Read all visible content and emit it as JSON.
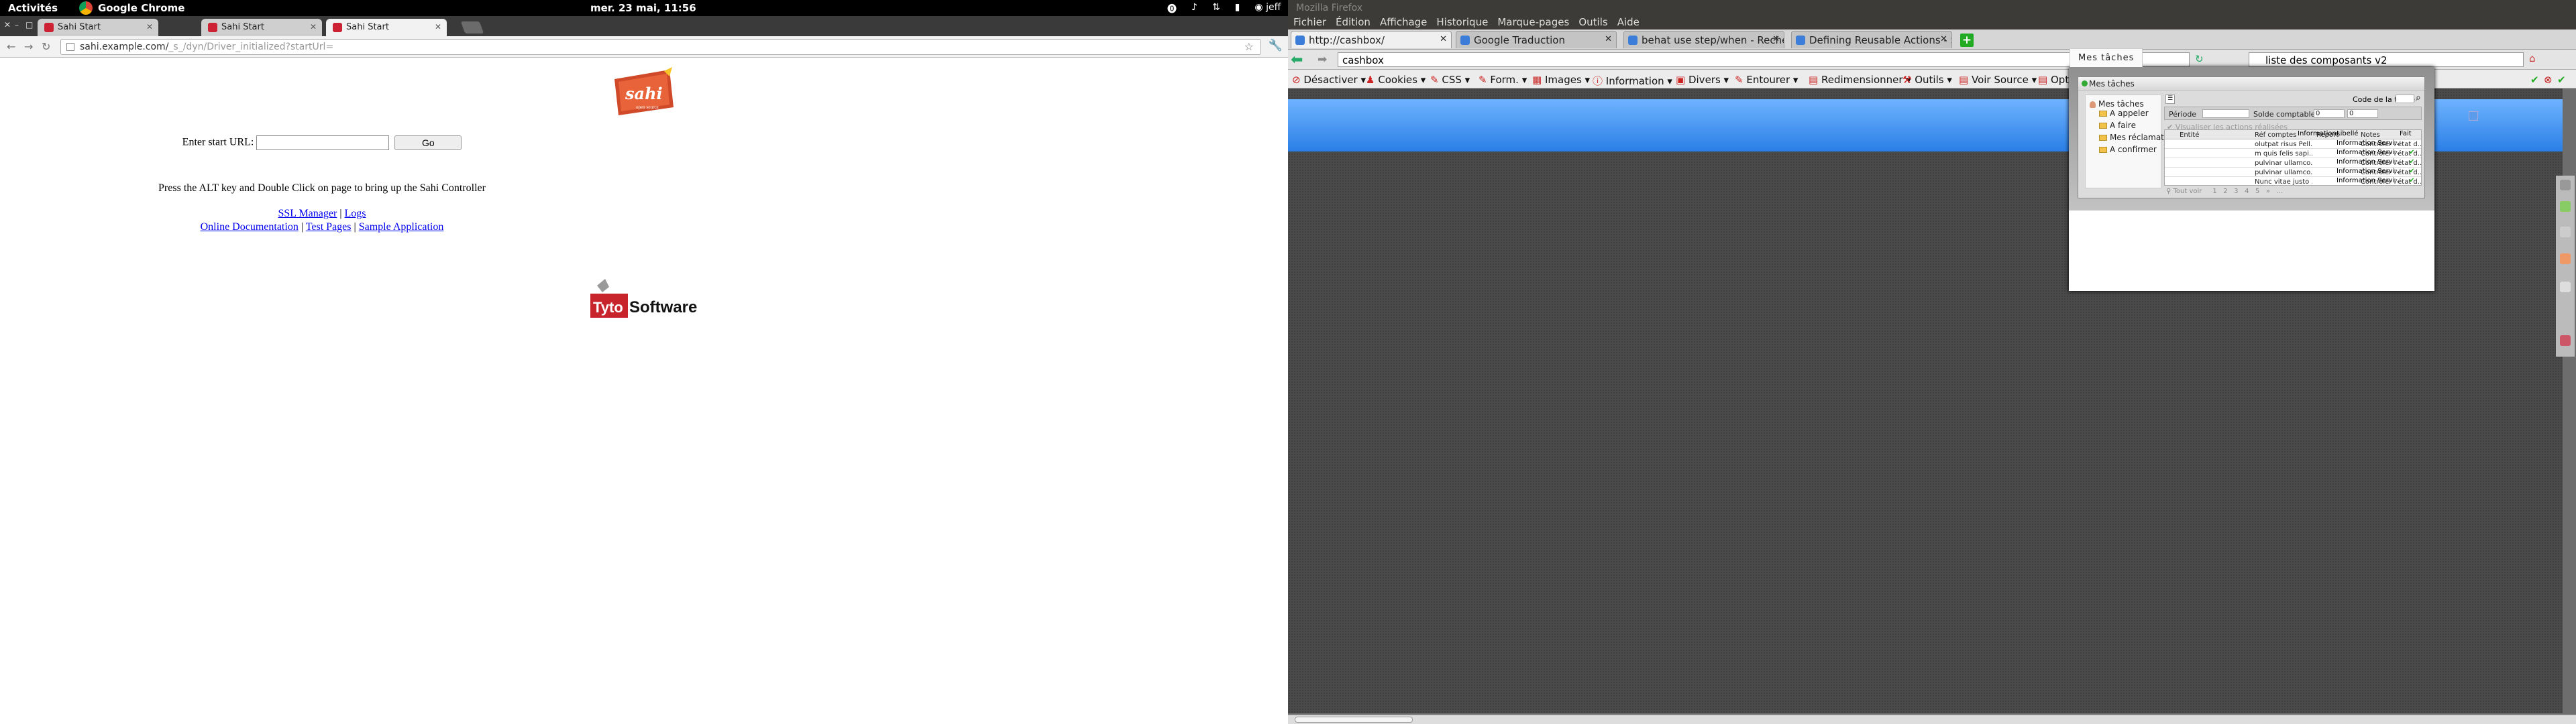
{
  "topbar": {
    "activities": "Activités",
    "app": "Google Chrome",
    "clock": "mer. 23 mai, 11:56",
    "user": "jeff"
  },
  "chrome": {
    "tabs": [
      {
        "label": "Sahi Start"
      },
      {
        "label": "Sahi Start"
      },
      {
        "label": "Sahi Start"
      }
    ],
    "url_host": "sahi.example.com/",
    "url_path": "_s_/dyn/Driver_initialized?startUrl="
  },
  "sahi": {
    "logo_text": "sahi",
    "logo_sub": "open source",
    "enter_label": "Enter start URL:",
    "go_label": "Go",
    "instruction": "Press the ALT key and Double Click on page to bring up the Sahi Controller",
    "links": {
      "ssl": "SSL Manager",
      "logs": "Logs",
      "docs": "Online Documentation",
      "tests": "Test Pages",
      "sample": "Sample Application"
    },
    "tyto_a": "Tyto",
    "tyto_b": "Software"
  },
  "firefox": {
    "title": "Mozilla Firefox",
    "menu": [
      "Fichier",
      "Édition",
      "Affichage",
      "Historique",
      "Marque-pages",
      "Outils",
      "Aide"
    ],
    "tabs": [
      {
        "label": "http://cashbox/"
      },
      {
        "label": "Google Traduction"
      },
      {
        "label": "behat use step/when - Reche..."
      },
      {
        "label": "Defining Reusable Actions - S..."
      }
    ],
    "url": "cashbox",
    "search": "liste des composants v2",
    "devbar": [
      "Désactiver",
      "Cookies",
      "CSS",
      "Form.",
      "Images",
      "Information",
      "Divers",
      "Entourer",
      "Redimensionner",
      "Outils",
      "Voir Source",
      "Options"
    ]
  },
  "app": {
    "tab_label": "Mes tâches",
    "dialog_title": "Mes tâches",
    "tree_root": "Mes tâches",
    "tree_items": [
      "A appeler",
      "A faire",
      "Mes réclamations",
      "A confirmer"
    ],
    "filters": {
      "periode": "Période",
      "solde": "Solde comptable",
      "solde_a": "0",
      "solde_b": "0",
      "code": "Code de la tâche"
    },
    "viz_label": "Visualiser les actions réalisées",
    "columns": [
      "Entité",
      "Réf comptes",
      "Report",
      "Notes",
      "Informations",
      "Libellé",
      "Fait"
    ],
    "rows": [
      {
        "ref": "olutpat risus Pell...",
        "notes": "Contrôler l'état d...",
        "lib": "Information Servi...",
        "done": ""
      },
      {
        "ref": "m quis felis sapi...",
        "notes": "Contrôler l'état d...",
        "lib": "Information Servi...",
        "done": "✔"
      },
      {
        "ref": "pulvinar ullamco...",
        "notes": "Contrôler l'état d...",
        "lib": "Information Servi...",
        "done": "✔"
      },
      {
        "ref": "pulvinar ullamco...",
        "notes": "Contrôler l'état d...",
        "lib": "Information Servi...",
        "done": "✔"
      },
      {
        "ref": "Nunc vitae justo ...",
        "notes": "Contrôler l'état d...",
        "lib": "Information Servi...",
        "done": "✔"
      }
    ],
    "pager": {
      "all": "Tout voir",
      "pages": [
        "1",
        "2",
        "3",
        "4",
        "5",
        "»",
        "..."
      ]
    }
  }
}
